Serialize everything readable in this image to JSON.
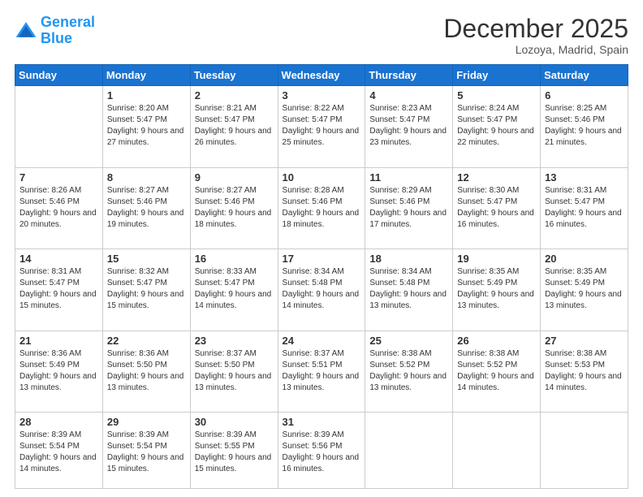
{
  "header": {
    "logo_line1": "General",
    "logo_line2": "Blue",
    "month": "December 2025",
    "location": "Lozoya, Madrid, Spain"
  },
  "weekdays": [
    "Sunday",
    "Monday",
    "Tuesday",
    "Wednesday",
    "Thursday",
    "Friday",
    "Saturday"
  ],
  "weeks": [
    [
      {
        "day": "",
        "sunrise": "",
        "sunset": "",
        "daylight": ""
      },
      {
        "day": "1",
        "sunrise": "8:20 AM",
        "sunset": "5:47 PM",
        "daylight": "9 hours and 27 minutes."
      },
      {
        "day": "2",
        "sunrise": "8:21 AM",
        "sunset": "5:47 PM",
        "daylight": "9 hours and 26 minutes."
      },
      {
        "day": "3",
        "sunrise": "8:22 AM",
        "sunset": "5:47 PM",
        "daylight": "9 hours and 25 minutes."
      },
      {
        "day": "4",
        "sunrise": "8:23 AM",
        "sunset": "5:47 PM",
        "daylight": "9 hours and 23 minutes."
      },
      {
        "day": "5",
        "sunrise": "8:24 AM",
        "sunset": "5:47 PM",
        "daylight": "9 hours and 22 minutes."
      },
      {
        "day": "6",
        "sunrise": "8:25 AM",
        "sunset": "5:46 PM",
        "daylight": "9 hours and 21 minutes."
      }
    ],
    [
      {
        "day": "7",
        "sunrise": "8:26 AM",
        "sunset": "5:46 PM",
        "daylight": "9 hours and 20 minutes."
      },
      {
        "day": "8",
        "sunrise": "8:27 AM",
        "sunset": "5:46 PM",
        "daylight": "9 hours and 19 minutes."
      },
      {
        "day": "9",
        "sunrise": "8:27 AM",
        "sunset": "5:46 PM",
        "daylight": "9 hours and 18 minutes."
      },
      {
        "day": "10",
        "sunrise": "8:28 AM",
        "sunset": "5:46 PM",
        "daylight": "9 hours and 18 minutes."
      },
      {
        "day": "11",
        "sunrise": "8:29 AM",
        "sunset": "5:46 PM",
        "daylight": "9 hours and 17 minutes."
      },
      {
        "day": "12",
        "sunrise": "8:30 AM",
        "sunset": "5:47 PM",
        "daylight": "9 hours and 16 minutes."
      },
      {
        "day": "13",
        "sunrise": "8:31 AM",
        "sunset": "5:47 PM",
        "daylight": "9 hours and 16 minutes."
      }
    ],
    [
      {
        "day": "14",
        "sunrise": "8:31 AM",
        "sunset": "5:47 PM",
        "daylight": "9 hours and 15 minutes."
      },
      {
        "day": "15",
        "sunrise": "8:32 AM",
        "sunset": "5:47 PM",
        "daylight": "9 hours and 15 minutes."
      },
      {
        "day": "16",
        "sunrise": "8:33 AM",
        "sunset": "5:47 PM",
        "daylight": "9 hours and 14 minutes."
      },
      {
        "day": "17",
        "sunrise": "8:34 AM",
        "sunset": "5:48 PM",
        "daylight": "9 hours and 14 minutes."
      },
      {
        "day": "18",
        "sunrise": "8:34 AM",
        "sunset": "5:48 PM",
        "daylight": "9 hours and 13 minutes."
      },
      {
        "day": "19",
        "sunrise": "8:35 AM",
        "sunset": "5:49 PM",
        "daylight": "9 hours and 13 minutes."
      },
      {
        "day": "20",
        "sunrise": "8:35 AM",
        "sunset": "5:49 PM",
        "daylight": "9 hours and 13 minutes."
      }
    ],
    [
      {
        "day": "21",
        "sunrise": "8:36 AM",
        "sunset": "5:49 PM",
        "daylight": "9 hours and 13 minutes."
      },
      {
        "day": "22",
        "sunrise": "8:36 AM",
        "sunset": "5:50 PM",
        "daylight": "9 hours and 13 minutes."
      },
      {
        "day": "23",
        "sunrise": "8:37 AM",
        "sunset": "5:50 PM",
        "daylight": "9 hours and 13 minutes."
      },
      {
        "day": "24",
        "sunrise": "8:37 AM",
        "sunset": "5:51 PM",
        "daylight": "9 hours and 13 minutes."
      },
      {
        "day": "25",
        "sunrise": "8:38 AM",
        "sunset": "5:52 PM",
        "daylight": "9 hours and 13 minutes."
      },
      {
        "day": "26",
        "sunrise": "8:38 AM",
        "sunset": "5:52 PM",
        "daylight": "9 hours and 14 minutes."
      },
      {
        "day": "27",
        "sunrise": "8:38 AM",
        "sunset": "5:53 PM",
        "daylight": "9 hours and 14 minutes."
      }
    ],
    [
      {
        "day": "28",
        "sunrise": "8:39 AM",
        "sunset": "5:54 PM",
        "daylight": "9 hours and 14 minutes."
      },
      {
        "day": "29",
        "sunrise": "8:39 AM",
        "sunset": "5:54 PM",
        "daylight": "9 hours and 15 minutes."
      },
      {
        "day": "30",
        "sunrise": "8:39 AM",
        "sunset": "5:55 PM",
        "daylight": "9 hours and 15 minutes."
      },
      {
        "day": "31",
        "sunrise": "8:39 AM",
        "sunset": "5:56 PM",
        "daylight": "9 hours and 16 minutes."
      },
      {
        "day": "",
        "sunrise": "",
        "sunset": "",
        "daylight": ""
      },
      {
        "day": "",
        "sunrise": "",
        "sunset": "",
        "daylight": ""
      },
      {
        "day": "",
        "sunrise": "",
        "sunset": "",
        "daylight": ""
      }
    ]
  ],
  "labels": {
    "sunrise_prefix": "Sunrise: ",
    "sunset_prefix": "Sunset: ",
    "daylight_prefix": "Daylight: "
  }
}
